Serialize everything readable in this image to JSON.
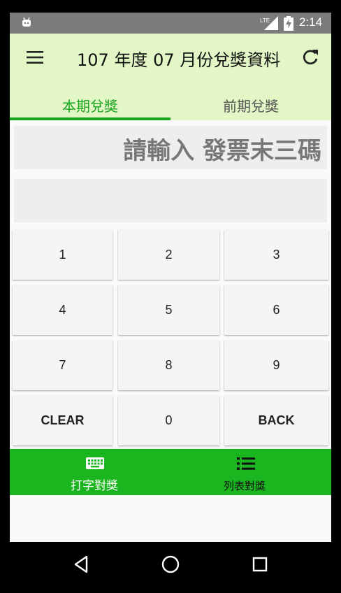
{
  "status_bar": {
    "time": "2:14",
    "network": "LTE"
  },
  "app_bar": {
    "title": "107 年度 07 月份兌獎資料",
    "menu_icon": "hamburger-menu-icon",
    "refresh_icon": "refresh-icon"
  },
  "tabs": [
    {
      "label": "本期兌獎",
      "selected": true
    },
    {
      "label": "前期兌獎",
      "selected": false
    }
  ],
  "input": {
    "prompt": "請輸入 發票末三碼",
    "result": ""
  },
  "keypad": [
    [
      "1",
      "2",
      "3"
    ],
    [
      "4",
      "5",
      "6"
    ],
    [
      "7",
      "8",
      "9"
    ],
    [
      "CLEAR",
      "0",
      "BACK"
    ]
  ],
  "bottom_nav": [
    {
      "label": "打字對獎",
      "icon": "keyboard-icon"
    },
    {
      "label": "列表對獎",
      "icon": "list-icon"
    }
  ],
  "colors": {
    "app_bar_bg": "#e3f7c6",
    "accent": "#1aa31f",
    "bottom_nav_bg": "#1ab51f",
    "status_bar_bg": "#7b7b7b"
  }
}
